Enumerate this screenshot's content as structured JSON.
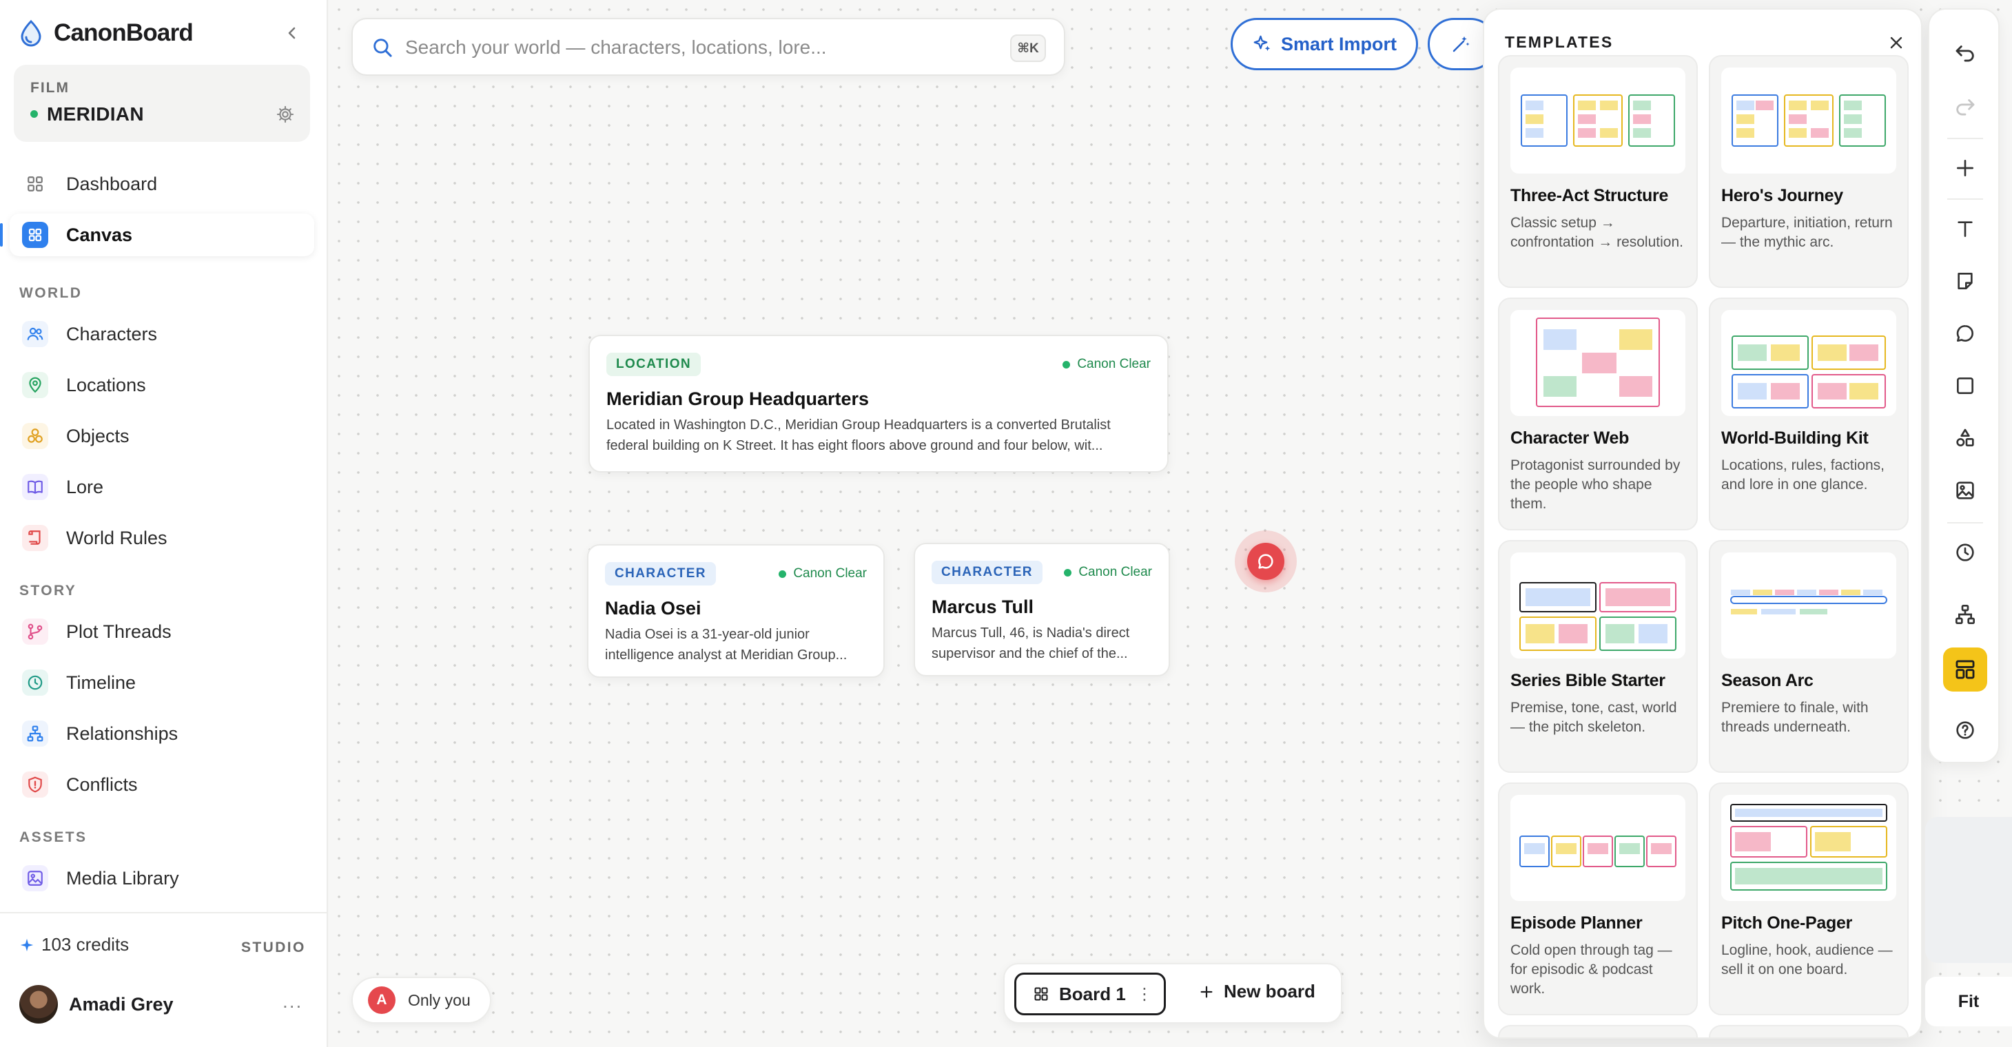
{
  "brand": {
    "name": "CanonBoard"
  },
  "project": {
    "label": "FILM",
    "name": "MERIDIAN"
  },
  "nav": {
    "top": [
      {
        "label": "Dashboard"
      },
      {
        "label": "Canvas"
      }
    ],
    "sections": [
      {
        "title": "WORLD",
        "items": [
          {
            "label": "Characters"
          },
          {
            "label": "Locations"
          },
          {
            "label": "Objects"
          },
          {
            "label": "Lore"
          },
          {
            "label": "World Rules"
          }
        ]
      },
      {
        "title": "STORY",
        "items": [
          {
            "label": "Plot Threads"
          },
          {
            "label": "Timeline"
          },
          {
            "label": "Relationships"
          },
          {
            "label": "Conflicts"
          }
        ]
      },
      {
        "title": "ASSETS",
        "items": [
          {
            "label": "Media Library"
          }
        ]
      }
    ]
  },
  "footer": {
    "credits": "103 credits",
    "plan": "STUDIO",
    "user": "Amadi Grey",
    "more": "..."
  },
  "search": {
    "placeholder": "Search your world — characters, locations, lore...",
    "shortcut": "⌘K"
  },
  "actions": {
    "smart_import": "Smart Import"
  },
  "cards": [
    {
      "tag": "LOCATION",
      "status": "Canon Clear",
      "title": "Meridian Group Headquarters",
      "desc": "Located in Washington D.C., Meridian Group Headquarters is a converted Brutalist federal building on K Street. It has eight floors above ground and four below, wit..."
    },
    {
      "tag": "CHARACTER",
      "status": "Canon Clear",
      "title": "Nadia Osei",
      "desc": "Nadia Osei is a 31-year-old junior intelligence analyst at Meridian Group..."
    },
    {
      "tag": "CHARACTER",
      "status": "Canon Clear",
      "title": "Marcus Tull",
      "desc": "Marcus Tull, 46, is Nadia's direct supervisor and the chief of the..."
    }
  ],
  "presence": {
    "initial": "A",
    "label": "Only you"
  },
  "boards": {
    "current": "Board 1",
    "menu": "⋮",
    "new_label": "New board"
  },
  "templates": {
    "title": "TEMPLATES",
    "items": [
      {
        "name": "Three-Act Structure",
        "desc": "Classic setup → confrontation → resolution."
      },
      {
        "name": "Hero's Journey",
        "desc": "Departure, initiation, return — the mythic arc."
      },
      {
        "name": "Character Web",
        "desc": "Protagonist surrounded by the people who shape them."
      },
      {
        "name": "World-Building Kit",
        "desc": "Locations, rules, factions, and lore in one glance."
      },
      {
        "name": "Series Bible Starter",
        "desc": "Premise, tone, cast, world — the pitch skeleton."
      },
      {
        "name": "Season Arc",
        "desc": "Premiere to finale, with threads underneath."
      },
      {
        "name": "Episode Planner",
        "desc": "Cold open through tag — for episodic & podcast work."
      },
      {
        "name": "Pitch One-Pager",
        "desc": "Logline, hook, audience — sell it on one board."
      }
    ]
  },
  "toolbar": {
    "tools": [
      "undo-icon",
      "redo-icon",
      "add-icon",
      "text-icon",
      "sticky-note-icon",
      "comment-icon",
      "frame-icon",
      "shapes-icon",
      "image-icon",
      "history-icon",
      "hierarchy-icon",
      "templates-icon",
      "help-icon"
    ],
    "active": "templates-icon"
  },
  "zoom": {
    "fit_label": "Fit"
  },
  "colors": {
    "accent": "#2f80ed",
    "canon_green": "#25b36b",
    "active_tool": "#f4c419",
    "comment_red": "#e5484d"
  }
}
